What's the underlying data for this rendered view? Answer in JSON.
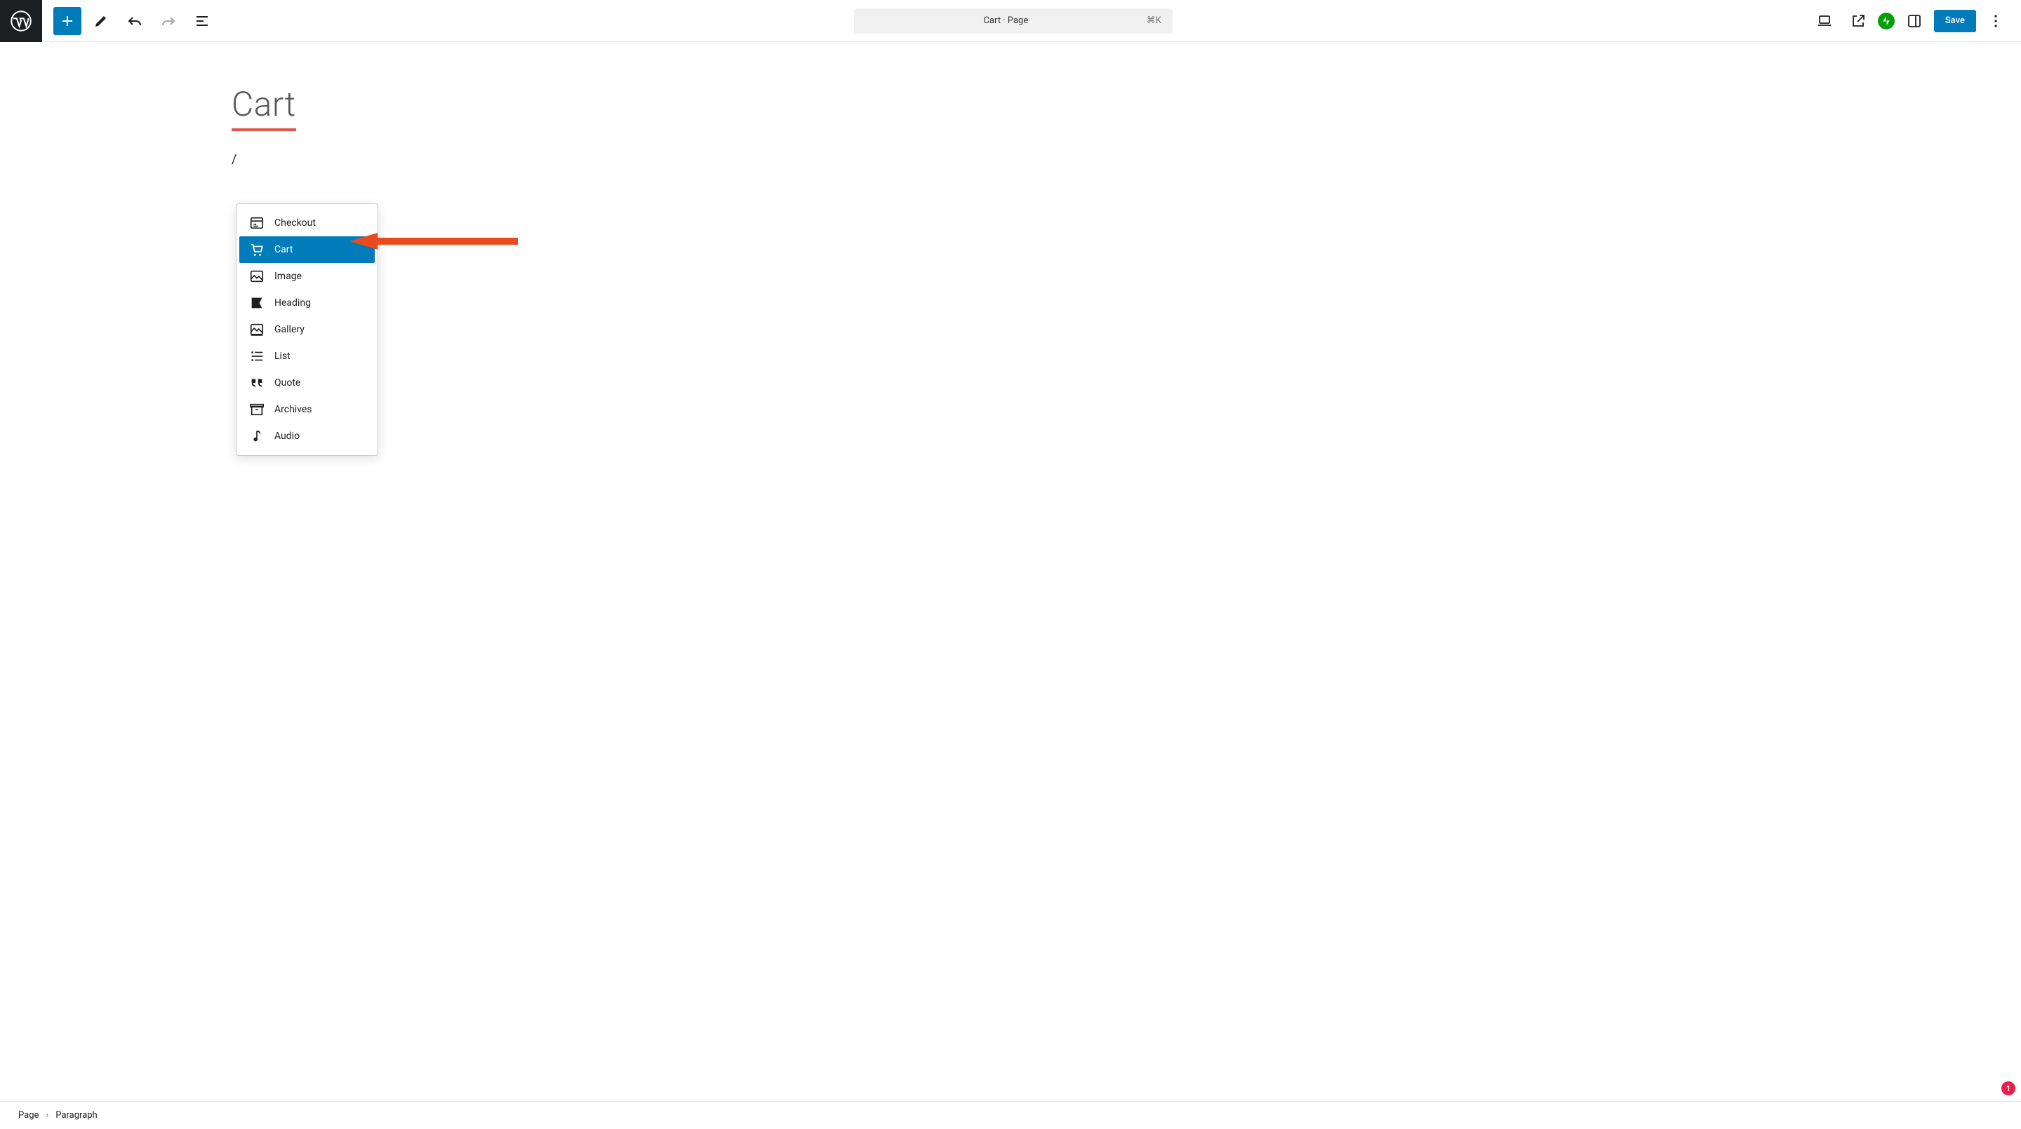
{
  "doc": {
    "title": "Cart · Page",
    "shortcut": "⌘K"
  },
  "toolbar": {
    "save": "Save"
  },
  "page": {
    "title": "Cart",
    "slash": "/"
  },
  "inserter": {
    "items": [
      {
        "label": "Checkout",
        "icon": "checkout",
        "selected": false
      },
      {
        "label": "Cart",
        "icon": "cart",
        "selected": true
      },
      {
        "label": "Image",
        "icon": "image",
        "selected": false
      },
      {
        "label": "Heading",
        "icon": "heading",
        "selected": false
      },
      {
        "label": "Gallery",
        "icon": "gallery",
        "selected": false
      },
      {
        "label": "List",
        "icon": "list",
        "selected": false
      },
      {
        "label": "Quote",
        "icon": "quote",
        "selected": false
      },
      {
        "label": "Archives",
        "icon": "archives",
        "selected": false
      },
      {
        "label": "Audio",
        "icon": "audio",
        "selected": false
      }
    ]
  },
  "breadcrumb": {
    "root": "Page",
    "leaf": "Paragraph"
  },
  "badge": "1"
}
